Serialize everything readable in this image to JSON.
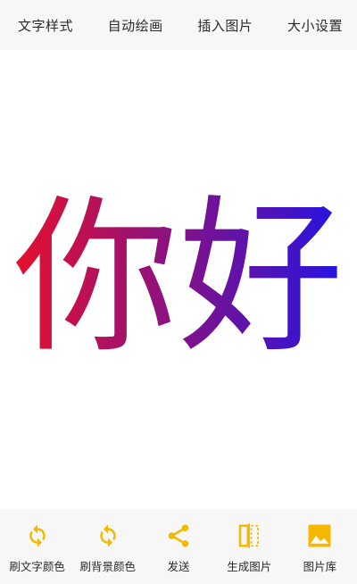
{
  "top_tabs": [
    {
      "label": "文字样式"
    },
    {
      "label": "自动绘画"
    },
    {
      "label": "插入图片"
    },
    {
      "label": "大小设置"
    }
  ],
  "canvas": {
    "text": "你好",
    "gradient_start": "#e8102a",
    "gradient_end": "#1f14e6"
  },
  "bottom_tools": [
    {
      "label": "刷文字颜色",
      "icon": "refresh-icon"
    },
    {
      "label": "刷背景颜色",
      "icon": "refresh-icon"
    },
    {
      "label": "发送",
      "icon": "share-icon"
    },
    {
      "label": "生成图片",
      "icon": "split-page-icon"
    },
    {
      "label": "图片库",
      "icon": "image-icon"
    }
  ],
  "colors": {
    "accent": "#f5b800",
    "bar_background": "#f7f7f7"
  }
}
